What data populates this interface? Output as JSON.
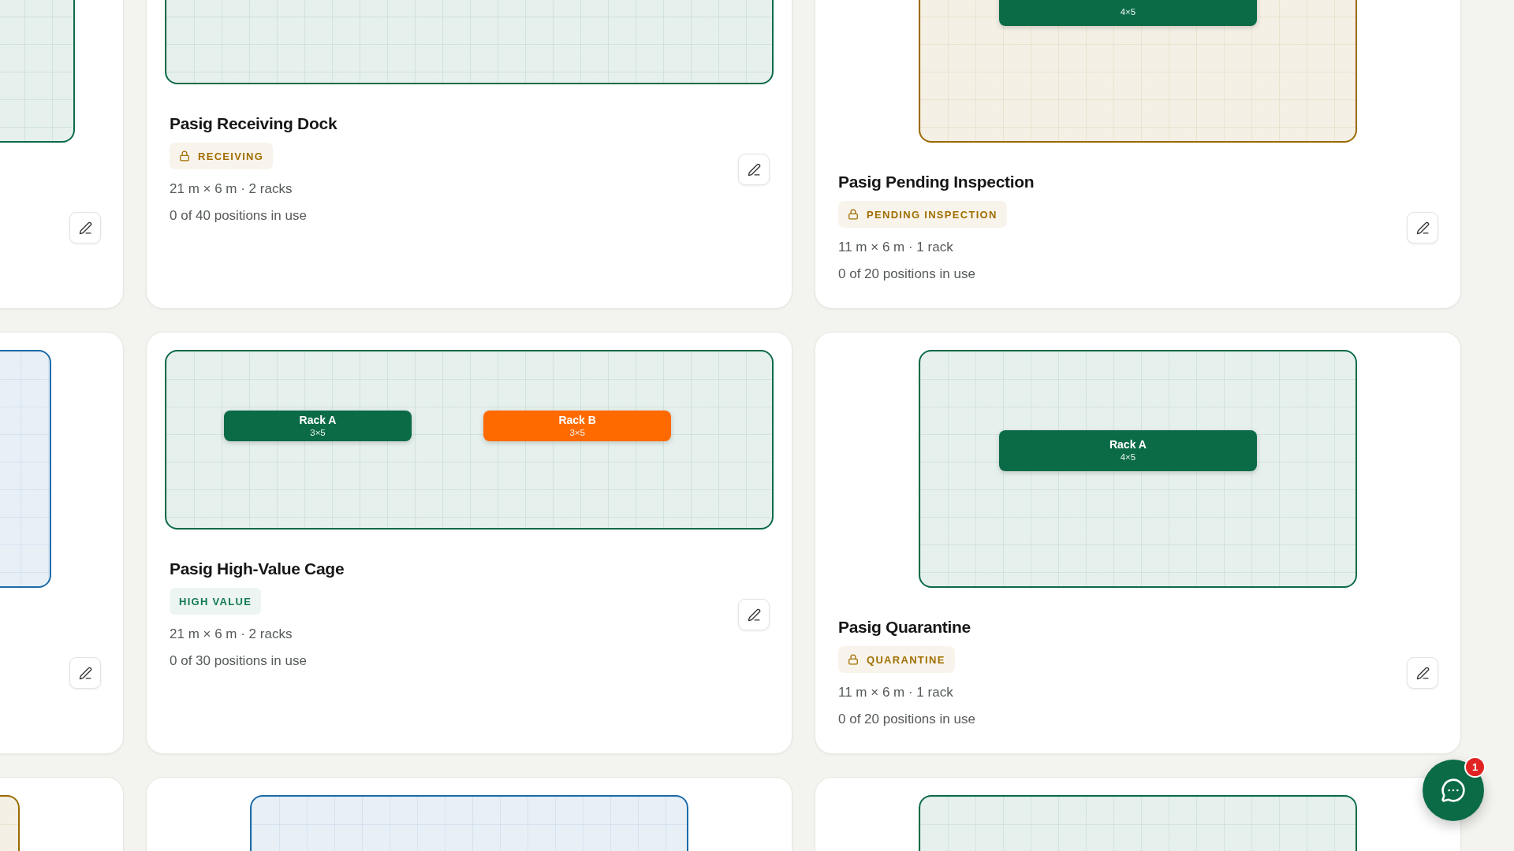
{
  "zones": [
    {
      "floor_plan": {
        "kind": "long",
        "color": "#0b6b47"
      },
      "actions": [
        {
          "kind": "edit"
        }
      ]
    },
    {
      "floor_plan": {
        "kind": "wide",
        "color": "#0b6b47"
      },
      "title": "Pasig Receiving Dock",
      "badge": {
        "label": "RECEIVING",
        "locked": true,
        "color": "#a06e00"
      },
      "dimensions": "21 m × 6 m · 2 racks",
      "usage": "0 of 40 positions in use",
      "actions": [
        {
          "kind": "edit"
        }
      ]
    },
    {
      "floor_plan": {
        "kind": "compact",
        "color": "#9a6a00",
        "racks": [
          {
            "size": "4×5",
            "color": "#0b6b47"
          }
        ]
      },
      "title": "Pasig Pending Inspection",
      "badge": {
        "label": "PENDING INSPECTION",
        "locked": true,
        "color": "#a06e00"
      },
      "dimensions": "11 m × 6 m · 1 rack",
      "usage": "0 of 20 positions in use",
      "actions": [
        {
          "kind": "edit"
        }
      ]
    },
    {
      "floor_plan": {
        "kind": "medium",
        "color": "#1c6aa8"
      },
      "actions": [
        {
          "kind": "edit"
        }
      ]
    },
    {
      "floor_plan": {
        "kind": "wide",
        "color": "#0b6b47",
        "racks": [
          {
            "name": "Rack A",
            "size": "3×5",
            "color": "#0b6b47"
          },
          {
            "name": "Rack B",
            "size": "3×5",
            "color": "#ff6a00"
          }
        ]
      },
      "title": "Pasig High-Value Cage",
      "badge": {
        "label": "HIGH VALUE",
        "locked": false,
        "color": "#127a52"
      },
      "dimensions": "21 m × 6 m · 2 racks",
      "usage": "0 of 30 positions in use",
      "actions": [
        {
          "kind": "edit"
        }
      ]
    },
    {
      "floor_plan": {
        "kind": "compact",
        "color": "#0b6b47",
        "racks": [
          {
            "name": "Rack A",
            "size": "4×5",
            "color": "#0b6b47"
          }
        ]
      },
      "title": "Pasig Quarantine",
      "badge": {
        "label": "QUARANTINE",
        "locked": true,
        "color": "#a06e00"
      },
      "dimensions": "11 m × 6 m · 1 rack",
      "usage": "0 of 20 positions in use",
      "actions": [
        {
          "kind": "edit"
        }
      ]
    },
    {
      "floor_plan": {
        "kind": "compact",
        "color": "#9a6a00"
      }
    },
    {
      "floor_plan": {
        "kind": "compact",
        "color": "#1c6aa8"
      }
    },
    {
      "floor_plan": {
        "kind": "compact",
        "color": "#0b6b47"
      }
    }
  ],
  "chat_button": {
    "badge": "1"
  }
}
